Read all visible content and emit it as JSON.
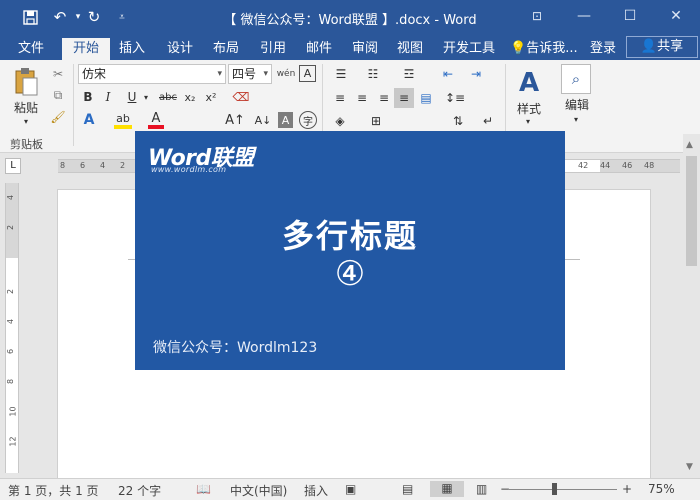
{
  "titlebar": {
    "title": "【 微信公众号：Word联盟 】.docx - Word",
    "save_icon": "save-icon",
    "undo_icon": "undo-icon",
    "redo_icon": "redo-icon",
    "customize_icon": "customize-qat-icon",
    "bg_color": "#2b579a"
  },
  "tabs": [
    "文件",
    "开始",
    "插入",
    "设计",
    "布局",
    "引用",
    "邮件",
    "审阅",
    "视图",
    "开发工具"
  ],
  "active_tab": "开始",
  "tell_me": "告诉我...",
  "login": "登录",
  "share": "共享",
  "ribbon": {
    "paste_label": "粘贴",
    "clipboard_label": "剪贴板",
    "font_name": "仿宋",
    "font_size": "四号",
    "bold": "B",
    "italic": "I",
    "underline": "U",
    "strike": "abc",
    "subscript": "x₂",
    "superscript": "x²",
    "styles_label": "样式",
    "editing_label": "编辑"
  },
  "ruler": {
    "h_ticks": [
      "8",
      "6",
      "4",
      "2",
      "42",
      "44",
      "46",
      "48"
    ],
    "v_ticks": [
      "4",
      "2",
      "2",
      "4",
      "6",
      "8",
      "10",
      "12"
    ]
  },
  "card": {
    "logo": "Word联盟",
    "logo_sub": "www.wordlm.com",
    "headline": "多行标题",
    "number": "④",
    "footer": "微信公众号：Wordlm123",
    "bg_color": "#2258a4"
  },
  "status": {
    "page": "第 1 页，共 1 页",
    "words": "22 个字",
    "language": "中文(中国)",
    "mode": "插入",
    "zoom": "75%",
    "zoom_value": 75
  }
}
